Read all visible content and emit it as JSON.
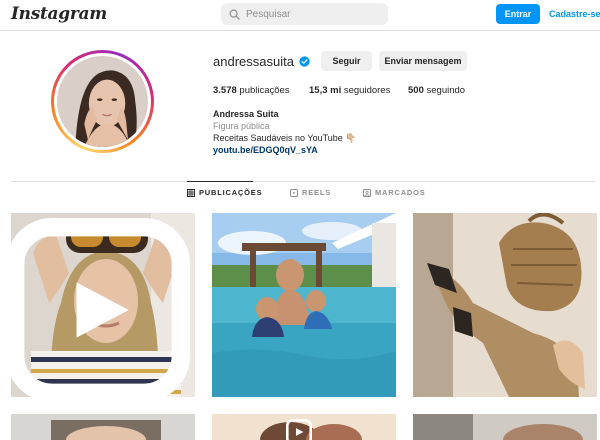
{
  "header": {
    "logo": "Instagram",
    "search_placeholder": "Pesquisar",
    "login_label": "Entrar",
    "signup_label": "Cadastre-se"
  },
  "profile": {
    "username": "andressasuita",
    "verified": true,
    "follow_label": "Seguir",
    "message_label": "Enviar mensagem",
    "stats": {
      "posts_value": "3.578",
      "posts_label": "publicações",
      "followers_value": "15,3 mi",
      "followers_label": "seguidores",
      "following_value": "500",
      "following_label": "seguindo"
    },
    "bio": {
      "name": "Andressa Suita",
      "category": "Figura pública",
      "description": "Receitas Saudáveis no YouTube 👇🏼",
      "link": "youtu.be/EDGQ0qV_sYA"
    }
  },
  "tabs": [
    {
      "label": "PUBLICAÇÕES",
      "icon": "grid-icon",
      "active": true
    },
    {
      "label": "REELS",
      "icon": "reels-icon",
      "active": false
    },
    {
      "label": "MARCADOS",
      "icon": "tagged-icon",
      "active": false
    }
  ],
  "colors": {
    "accent": "#0095f6",
    "link": "#00376b",
    "button_bg": "#efefef",
    "muted": "#8e8e8e"
  }
}
